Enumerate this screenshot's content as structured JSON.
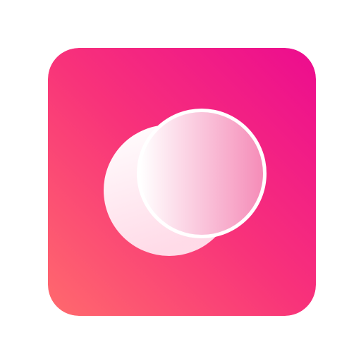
{
  "icon": {
    "name": "app-icon",
    "glyph": "overlapping-circles-icon",
    "colors": {
      "gradient_start": "#ff6a6d",
      "gradient_mid": "#f8327a",
      "gradient_end": "#ec0c8f",
      "glyph_white": "#ffffff",
      "glyph_pink": "#f58cb8"
    }
  }
}
